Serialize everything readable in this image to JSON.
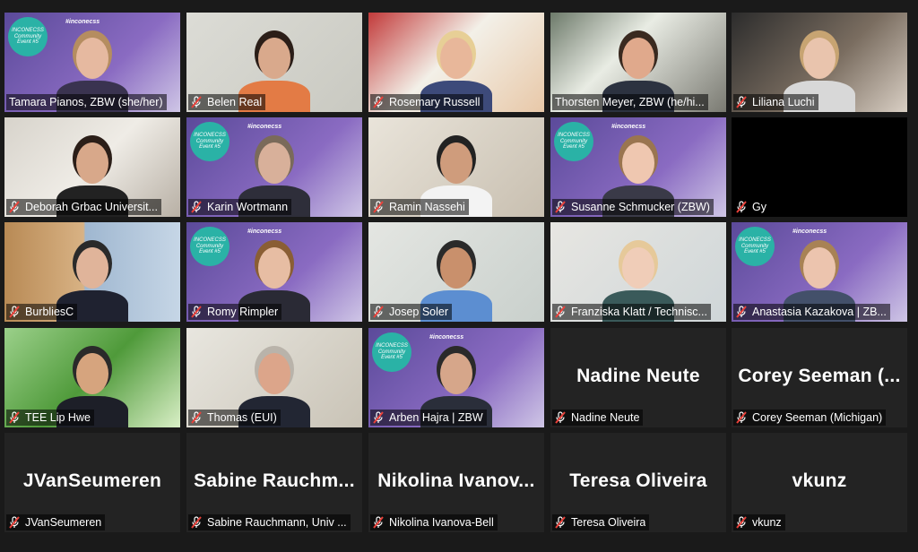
{
  "meeting": {
    "badge_text": "INCONECSS Community Event #5",
    "hashtag": "#inconecss",
    "colors": {
      "active_border": "#c8e06a",
      "mic_muted": "#e8413a",
      "tile_bg": "#232323",
      "badge": "#2ab2a6"
    }
  },
  "participants": [
    {
      "name": "Tamara Pianos, ZBW (she/her)",
      "video": true,
      "muted": false
    },
    {
      "name": "Belen Real",
      "video": true,
      "muted": true
    },
    {
      "name": "Rosemary Russell",
      "video": true,
      "muted": true
    },
    {
      "name": "Thorsten Meyer, ZBW (he/hi...",
      "video": true,
      "muted": false,
      "active": true
    },
    {
      "name": "Liliana Luchi",
      "video": true,
      "muted": true
    },
    {
      "name": "Deborah Grbac Universit...",
      "video": true,
      "muted": true
    },
    {
      "name": "Karin Wortmann",
      "video": true,
      "muted": true
    },
    {
      "name": "Ramin Nassehi",
      "video": true,
      "muted": true
    },
    {
      "name": "Susanne Schmucker (ZBW)",
      "video": true,
      "muted": true
    },
    {
      "name": "Gy",
      "video": false,
      "muted": true,
      "display": ""
    },
    {
      "name": "BurbliesC",
      "video": true,
      "muted": true
    },
    {
      "name": "Romy Rimpler",
      "video": true,
      "muted": true
    },
    {
      "name": "Josep Soler",
      "video": true,
      "muted": true
    },
    {
      "name": "Franziska Klatt / Technisc...",
      "video": true,
      "muted": true
    },
    {
      "name": "Anastasia Kazakova | ZB...",
      "video": true,
      "muted": true
    },
    {
      "name": "TEE Lip Hwe",
      "video": true,
      "muted": true
    },
    {
      "name": "Thomas (EUI)",
      "video": true,
      "muted": true
    },
    {
      "name": "Arben Hajra | ZBW",
      "video": true,
      "muted": true
    },
    {
      "name": "Nadine Neute",
      "video": false,
      "muted": true,
      "display": "Nadine Neute"
    },
    {
      "name": "Corey Seeman (Michigan)",
      "video": false,
      "muted": true,
      "display": "Corey  Seeman  (..."
    },
    {
      "name": "JVanSeumeren",
      "video": false,
      "muted": true,
      "display": "JVanSeumeren"
    },
    {
      "name": "Sabine Rauchmann, Univ ...",
      "video": false,
      "muted": true,
      "display": "Sabine  Rauchm..."
    },
    {
      "name": "Nikolina Ivanova-Bell",
      "video": false,
      "muted": true,
      "display": "Nikolina  Ivanov..."
    },
    {
      "name": "Teresa Oliveira",
      "video": false,
      "muted": true,
      "display": "Teresa Oliveira"
    },
    {
      "name": "vkunz",
      "video": false,
      "muted": true,
      "display": "vkunz"
    }
  ]
}
